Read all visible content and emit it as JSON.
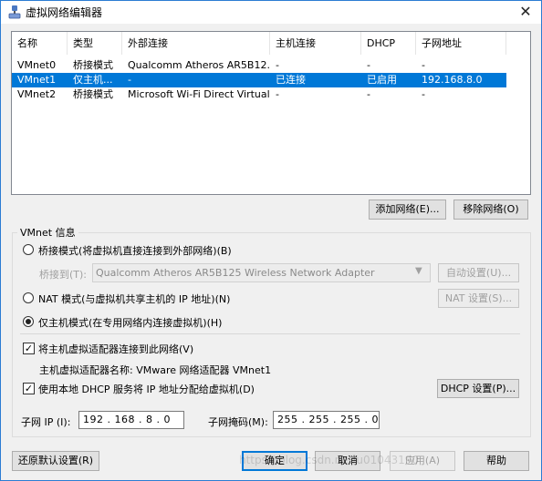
{
  "window": {
    "title": "虚拟网络编辑器",
    "close_glyph": "✕"
  },
  "network_list": {
    "columns": [
      "名称",
      "类型",
      "外部连接",
      "主机连接",
      "DHCP",
      "子网地址"
    ],
    "rows": [
      {
        "name": "VMnet0",
        "type": "桥接模式",
        "external": "Qualcomm Atheros AR5B12...",
        "host": "-",
        "dhcp": "-",
        "subnet": "-",
        "selected": false
      },
      {
        "name": "VMnet1",
        "type": "仅主机...",
        "external": "-",
        "host": "已连接",
        "dhcp": "已启用",
        "subnet": "192.168.8.0",
        "selected": true
      },
      {
        "name": "VMnet2",
        "type": "桥接模式",
        "external": "Microsoft Wi-Fi Direct Virtual...",
        "host": "-",
        "dhcp": "-",
        "subnet": "-",
        "selected": false
      }
    ]
  },
  "list_buttons": {
    "add": "添加网络(E)...",
    "remove": "移除网络(O)"
  },
  "vmnet_info": {
    "legend": "VMnet 信息",
    "bridged": {
      "label": "桥接模式(将虚拟机直接连接到外部网络)(B)",
      "selected": false
    },
    "bridge_to": {
      "label": "桥接到(T):",
      "value": "Qualcomm Atheros AR5B125 Wireless Network Adapter",
      "auto_btn": "自动设置(U)..."
    },
    "nat": {
      "label": "NAT 模式(与虚拟机共享主机的 IP 地址)(N)",
      "selected": false,
      "settings_btn": "NAT 设置(S)..."
    },
    "host_only": {
      "label": "仅主机模式(在专用网络内连接虚拟机)(H)",
      "selected": true
    },
    "connect_adapter": {
      "label": "将主机虚拟适配器连接到此网络(V)",
      "checked": true,
      "check_glyph": "✓"
    },
    "adapter_name": "主机虚拟适配器名称: VMware 网络适配器 VMnet1",
    "use_dhcp": {
      "label": "使用本地 DHCP 服务将 IP 地址分配给虚拟机(D)",
      "checked": true,
      "check_glyph": "✓",
      "dhcp_btn": "DHCP 设置(P)..."
    },
    "subnet_ip": {
      "label": "子网 IP (I):",
      "value": "192 . 168 . 8 . 0"
    },
    "subnet_mask": {
      "label": "子网掩码(M):",
      "value": "255 . 255 . 255 . 0"
    }
  },
  "footer": {
    "restore": "还原默认设置(R)",
    "ok": "确定",
    "cancel": "取消",
    "apply": "应用(A)",
    "help": "帮助"
  },
  "watermark": "https://blog.csdn.net/u01043190"
}
